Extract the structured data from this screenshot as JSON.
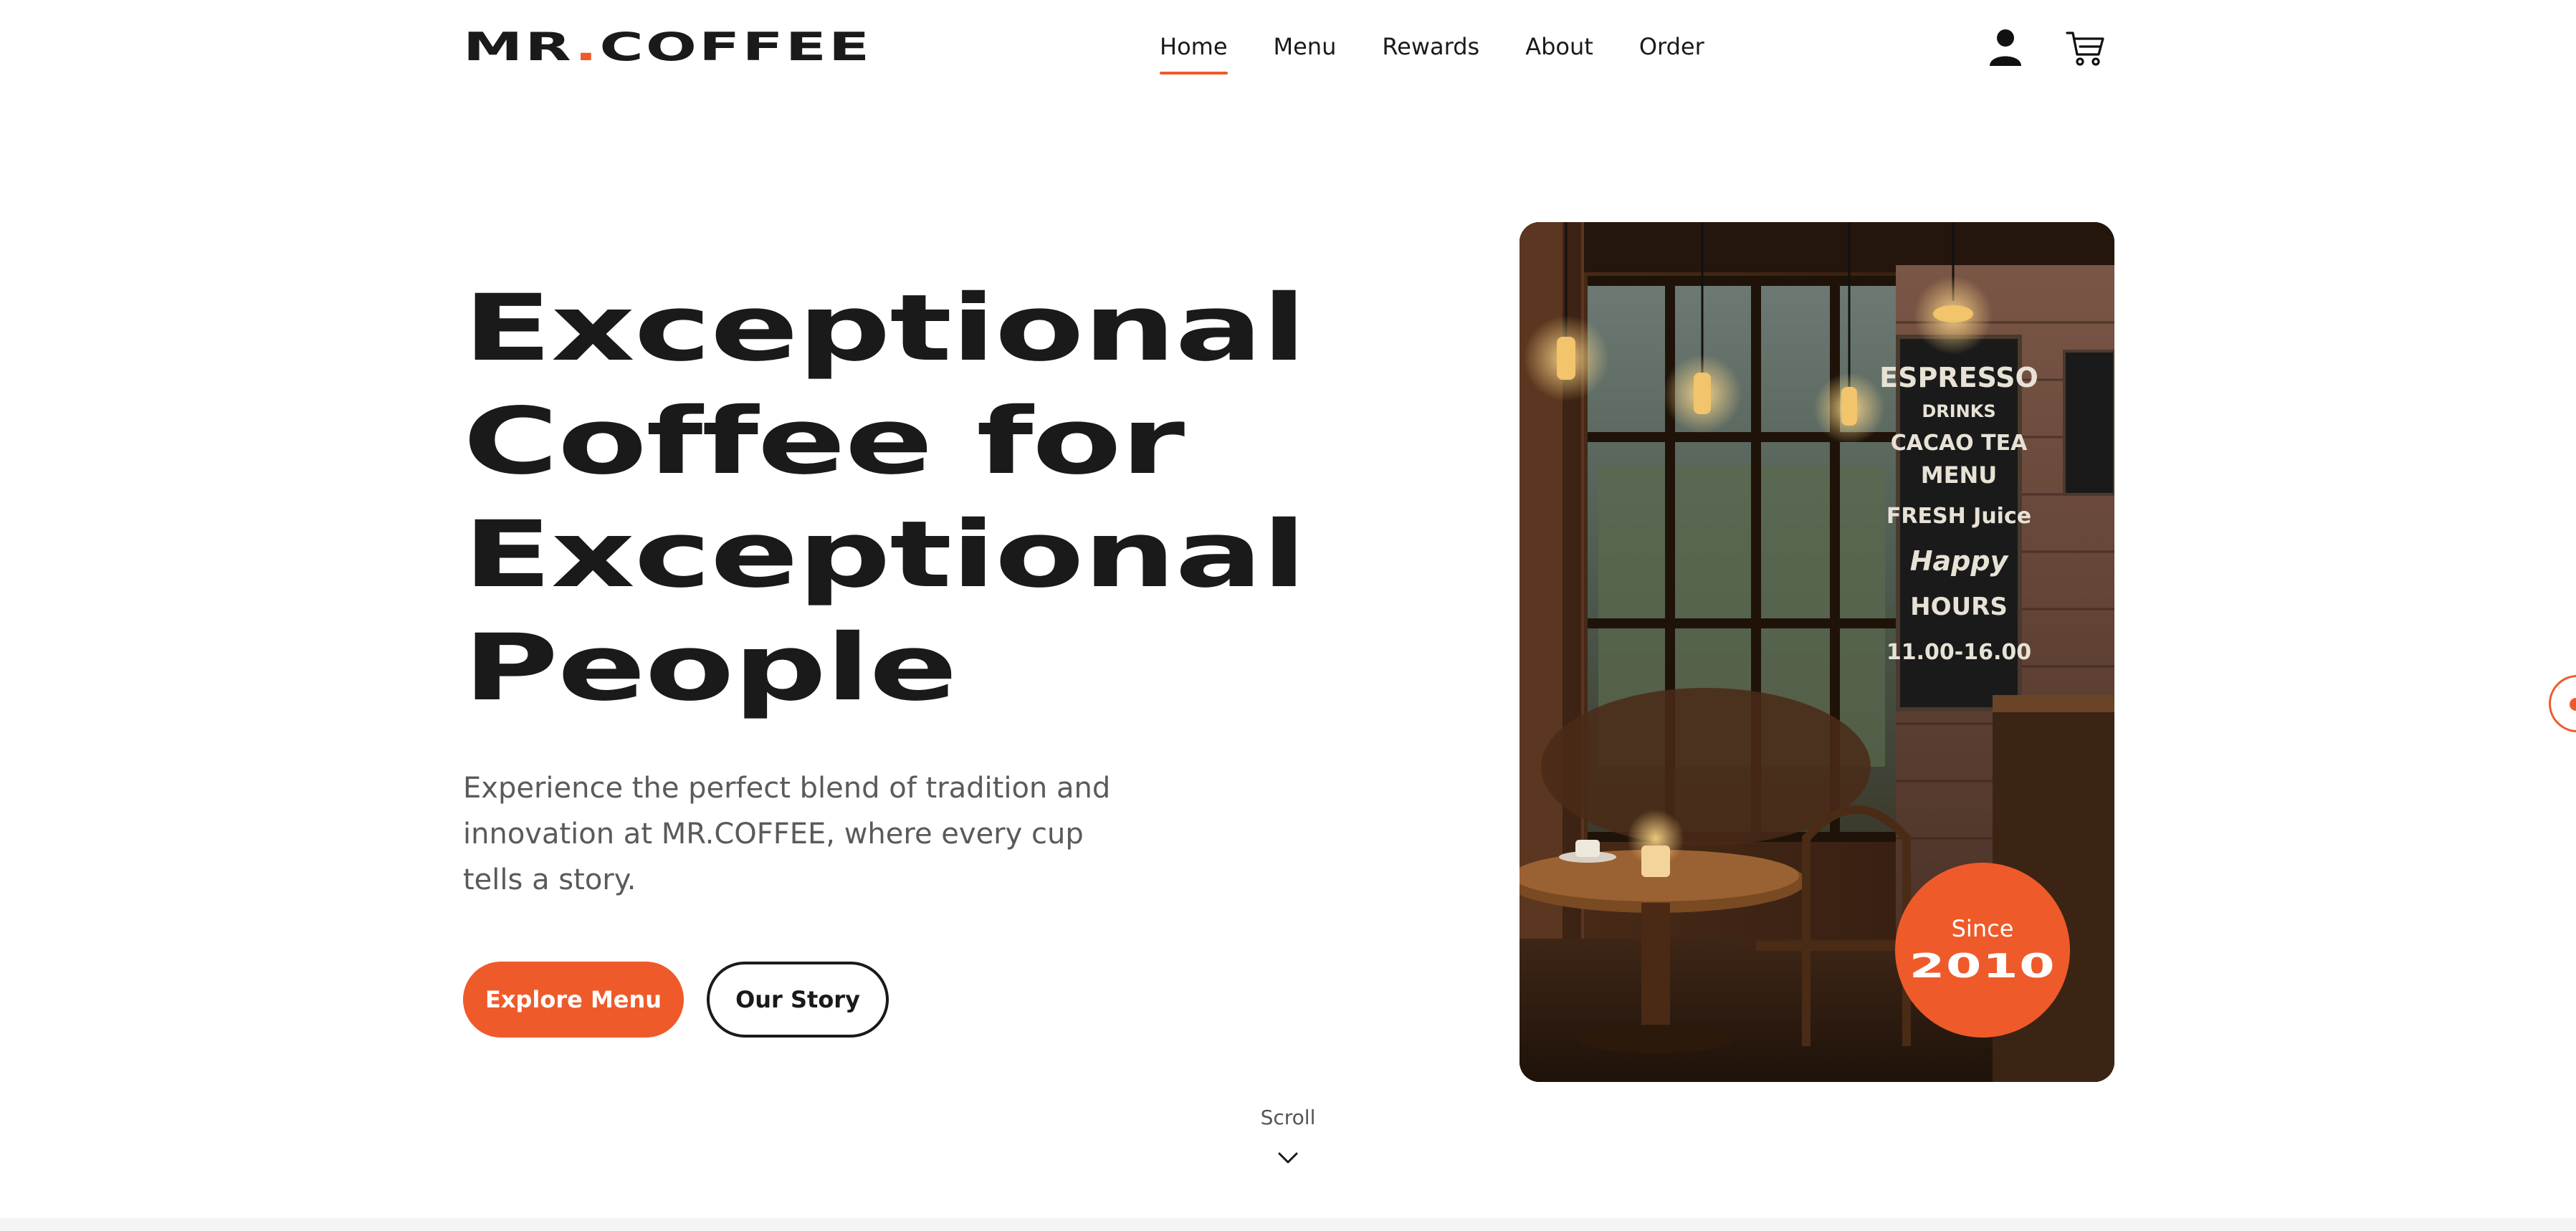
{
  "brand": {
    "logo_prefix": "MR",
    "logo_dot": ".",
    "logo_suffix": "COFFEE",
    "accent_color": "#ef5a2a",
    "text_color": "#1a1a1a"
  },
  "nav": {
    "items": [
      {
        "label": "Home",
        "active": true
      },
      {
        "label": "Menu",
        "active": false
      },
      {
        "label": "Rewards",
        "active": false
      },
      {
        "label": "About",
        "active": false
      },
      {
        "label": "Order",
        "active": false
      }
    ]
  },
  "header_icons": {
    "account": "user-icon",
    "cart": "cart-icon"
  },
  "hero": {
    "title_lines": [
      "Exceptional",
      "Coffee for",
      "Exceptional",
      "People"
    ],
    "subtitle": "Experience the perfect blend of tradition and innovation at MR.COFFEE, where every cup tells a story.",
    "primary_button": "Explore Menu",
    "secondary_button": "Our Story",
    "badge": {
      "label": "Since",
      "year": "2010"
    }
  },
  "chalkboard": {
    "lines": [
      "ESPRESSO",
      "DRINKS",
      "CACAO TEA",
      "MENU",
      "FRESH Juice",
      "Happy",
      "HOURS",
      "11.00-16.00"
    ]
  },
  "scroll": {
    "label": "Scroll",
    "icon": "chevron-down-icon"
  }
}
